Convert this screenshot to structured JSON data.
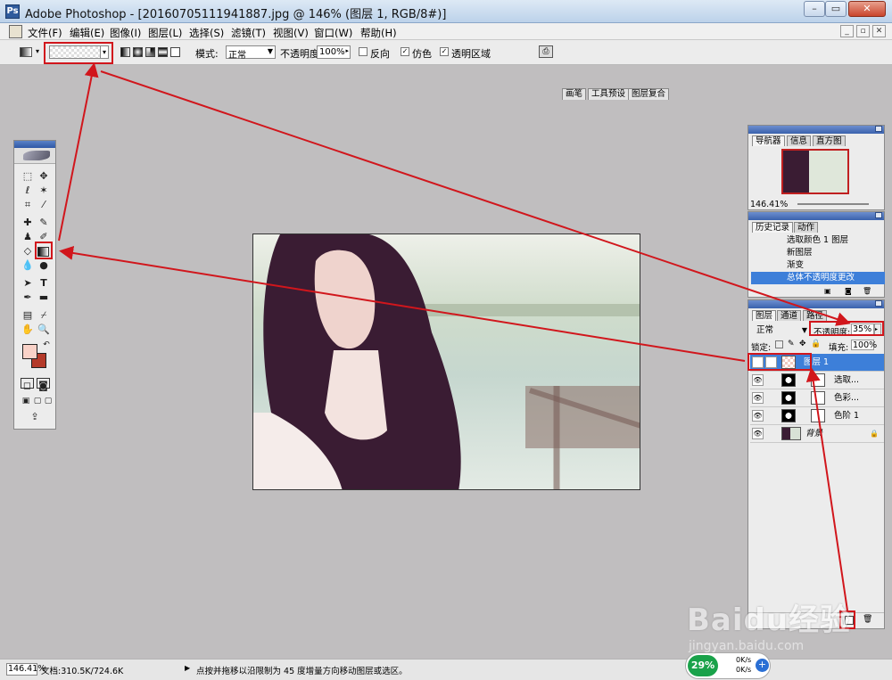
{
  "window": {
    "title": "Adobe Photoshop - [20160705111941887.jpg @ 146% (图层 1, RGB/8#)]",
    "app_icon": "photoshop-icon"
  },
  "menu": [
    "文件(F)",
    "编辑(E)",
    "图像(I)",
    "图层(L)",
    "选择(S)",
    "滤镜(T)",
    "视图(V)",
    "窗口(W)",
    "帮助(H)"
  ],
  "options": {
    "mode_label": "模式:",
    "mode_value": "正常",
    "opacity_label": "不透明度:",
    "opacity_value": "100%",
    "reverse_label": "反向",
    "dither_label": "仿色",
    "transparency_label": "透明区域",
    "dither_checked": true,
    "transparency_checked": true,
    "reverse_checked": false,
    "palette_tabs": [
      "画笔",
      "工具预设",
      "图层复合"
    ]
  },
  "navigator": {
    "tabs": [
      "导航器",
      "信息",
      "直方图"
    ],
    "zoom": "146.41%"
  },
  "history": {
    "tabs": [
      "历史记录",
      "动作"
    ],
    "items": [
      "选取颜色 1 图层",
      "新图层",
      "渐变",
      "总体不透明度更改"
    ],
    "selected_index": 3
  },
  "layers": {
    "tabs": [
      "图层",
      "通道",
      "路径"
    ],
    "blend_mode": "正常",
    "opacity_label": "不透明度:",
    "opacity_value": "35%",
    "lock_label": "锁定:",
    "fill_label": "填充:",
    "fill_value": "100%",
    "items": [
      {
        "name": "图层 1",
        "selected": true
      },
      {
        "name": "选取...",
        "selected": false
      },
      {
        "name": "色彩...",
        "selected": false
      },
      {
        "name": "色阶 1",
        "selected": false
      },
      {
        "name": "背景",
        "selected": false
      }
    ]
  },
  "status": {
    "zoom": "146.41%",
    "doc": "文档:310.5K/724.6K",
    "hint": "点按并拖移以沿限制为 45 度增量方向移动图层或选区。"
  },
  "overlay": {
    "watermark": "Baidu经验",
    "watermark_url": "jingyan.baidu.com",
    "net_percent": "29%",
    "net_up": "0K/s",
    "net_down": "0K/s"
  },
  "colors": {
    "selection_blue": "#3d7fd9",
    "annotation_red": "#d1161c",
    "foreground": "#f9d2c8",
    "background": "#b43a2a"
  }
}
